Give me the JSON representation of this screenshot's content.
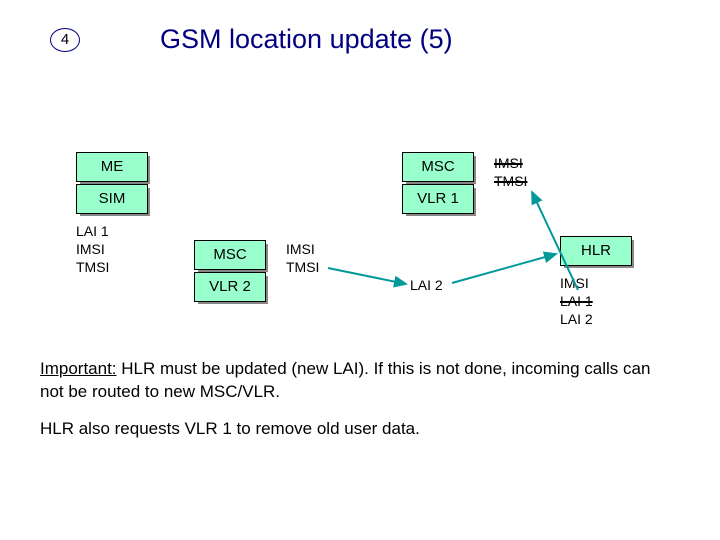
{
  "slide_number": "4",
  "title": "GSM location update (5)",
  "boxes": {
    "me": "ME",
    "sim": "SIM",
    "msc_a": "MSC",
    "vlr1": "VLR 1",
    "msc_b": "MSC",
    "vlr2": "VLR 2",
    "hlr": "HLR"
  },
  "labels": {
    "sim_data_l1": "LAI 1",
    "sim_data_l2": "IMSI",
    "sim_data_l3": "TMSI",
    "vlr1_data_l1": "IMSI",
    "vlr1_data_l2": "TMSI",
    "vlr2_data_l1": "IMSI",
    "vlr2_data_l2": "TMSI",
    "vlr2_data_l3": "LAI 2",
    "hlr_data_l1": "IMSI",
    "hlr_data_l2": "LAI 1",
    "hlr_data_l3": "LAI 2"
  },
  "text": {
    "para1_prefix": "Important:",
    "para1_rest": " HLR must be updated (new LAI). If this is not done, incoming calls can not be routed to new MSC/VLR.",
    "para2": "HLR also requests VLR 1 to remove old user data."
  }
}
